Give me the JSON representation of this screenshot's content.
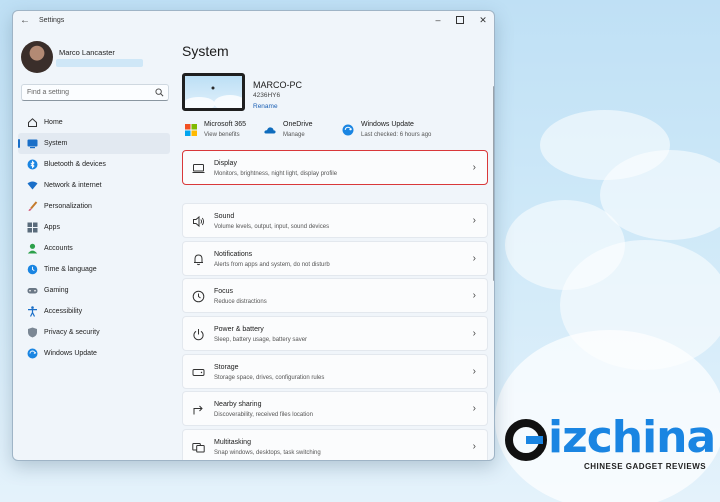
{
  "window": {
    "app_title": "Settings",
    "back_icon": "back-arrow-icon",
    "controls": [
      "minimize-icon",
      "maximize-icon",
      "close-icon"
    ]
  },
  "user": {
    "name": "Marco Lancaster"
  },
  "search": {
    "placeholder": "Find a setting",
    "icon": "search-icon"
  },
  "sidebar": {
    "items": [
      {
        "label": "Home",
        "icon": "home-icon",
        "active": false
      },
      {
        "label": "System",
        "icon": "system-icon",
        "active": true
      },
      {
        "label": "Bluetooth & devices",
        "icon": "bluetooth-icon",
        "active": false
      },
      {
        "label": "Network & internet",
        "icon": "network-icon",
        "active": false
      },
      {
        "label": "Personalization",
        "icon": "brush-icon",
        "active": false
      },
      {
        "label": "Apps",
        "icon": "apps-icon",
        "active": false
      },
      {
        "label": "Accounts",
        "icon": "accounts-icon",
        "active": false
      },
      {
        "label": "Time & language",
        "icon": "globe-clock-icon",
        "active": false
      },
      {
        "label": "Gaming",
        "icon": "gamepad-icon",
        "active": false
      },
      {
        "label": "Accessibility",
        "icon": "accessibility-icon",
        "active": false
      },
      {
        "label": "Privacy & security",
        "icon": "shield-icon",
        "active": false
      },
      {
        "label": "Windows Update",
        "icon": "update-icon",
        "active": false
      }
    ]
  },
  "main": {
    "title": "System",
    "pc": {
      "name": "MARCO-PC",
      "model": "4236HY6",
      "rename_label": "Rename"
    },
    "quick": [
      {
        "title": "Microsoft 365",
        "subtitle": "View benefits",
        "icon": "microsoft-icon"
      },
      {
        "title": "OneDrive",
        "subtitle": "Manage",
        "icon": "onedrive-icon"
      },
      {
        "title": "Windows Update",
        "subtitle": "Last checked: 6 hours ago",
        "icon": "update-icon"
      }
    ],
    "cards": [
      {
        "title": "Display",
        "subtitle": "Monitors, brightness, night light, display profile",
        "icon": "display-icon",
        "highlighted": true
      },
      {
        "title": "Sound",
        "subtitle": "Volume levels, output, input, sound devices",
        "icon": "speaker-icon"
      },
      {
        "title": "Notifications",
        "subtitle": "Alerts from apps and system, do not disturb",
        "icon": "bell-icon"
      },
      {
        "title": "Focus",
        "subtitle": "Reduce distractions",
        "icon": "focus-icon"
      },
      {
        "title": "Power & battery",
        "subtitle": "Sleep, battery usage, battery saver",
        "icon": "power-icon"
      },
      {
        "title": "Storage",
        "subtitle": "Storage space, drives, configuration rules",
        "icon": "storage-icon"
      },
      {
        "title": "Nearby sharing",
        "subtitle": "Discoverability, received files location",
        "icon": "share-icon"
      },
      {
        "title": "Multitasking",
        "subtitle": "Snap windows, desktops, task switching",
        "icon": "multitasking-icon"
      }
    ]
  },
  "watermark": {
    "logo_text": "Gizchina",
    "tagline": "CHINESE GADGET REVIEWS"
  },
  "colors": {
    "accent": "#1a6fc8",
    "highlight_border": "#d9383a",
    "watermark_blue": "#1a85e2"
  }
}
